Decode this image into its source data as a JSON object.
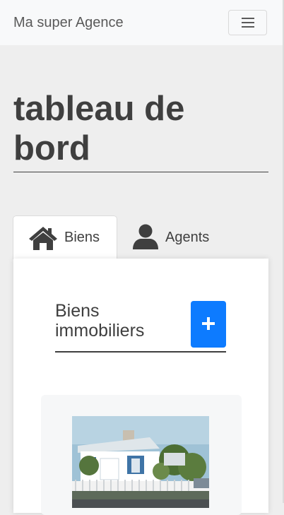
{
  "navbar": {
    "brand": "Ma super Agence",
    "menu_icon": "hamburger-icon"
  },
  "page": {
    "title": "tableau de bord"
  },
  "tabs": [
    {
      "label": "Biens",
      "icon": "home-icon",
      "active": true
    },
    {
      "label": "Agents",
      "icon": "user-icon",
      "active": false
    }
  ],
  "section": {
    "title": "Biens immobiliers",
    "add_icon": "plus-icon"
  },
  "colors": {
    "accent": "#0d7bff",
    "navbar_bg": "#f8f9fa",
    "page_bg": "#eeeeee",
    "text": "#3f3f3f"
  }
}
